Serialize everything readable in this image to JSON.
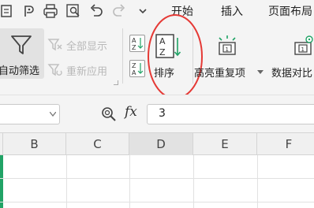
{
  "menu": {
    "tabs": [
      "开始",
      "插入",
      "页面布局"
    ]
  },
  "ribbon": {
    "autofilter_label": "自动筛选",
    "show_all_label": "全部显示",
    "reapply_label": "重新应用",
    "sort_label": "排序",
    "highlight_duplicates_label": "高亮重复项",
    "data_compare_label": "数据对比"
  },
  "formula": {
    "fx_label": "fx",
    "value": "3"
  },
  "columns": [
    "B",
    "C",
    "D",
    "E",
    "F"
  ],
  "colors": {
    "annotation_circle": "#e53935",
    "active_cell_green": "#21a366",
    "ribbon_bg": "#f4f4f4"
  }
}
